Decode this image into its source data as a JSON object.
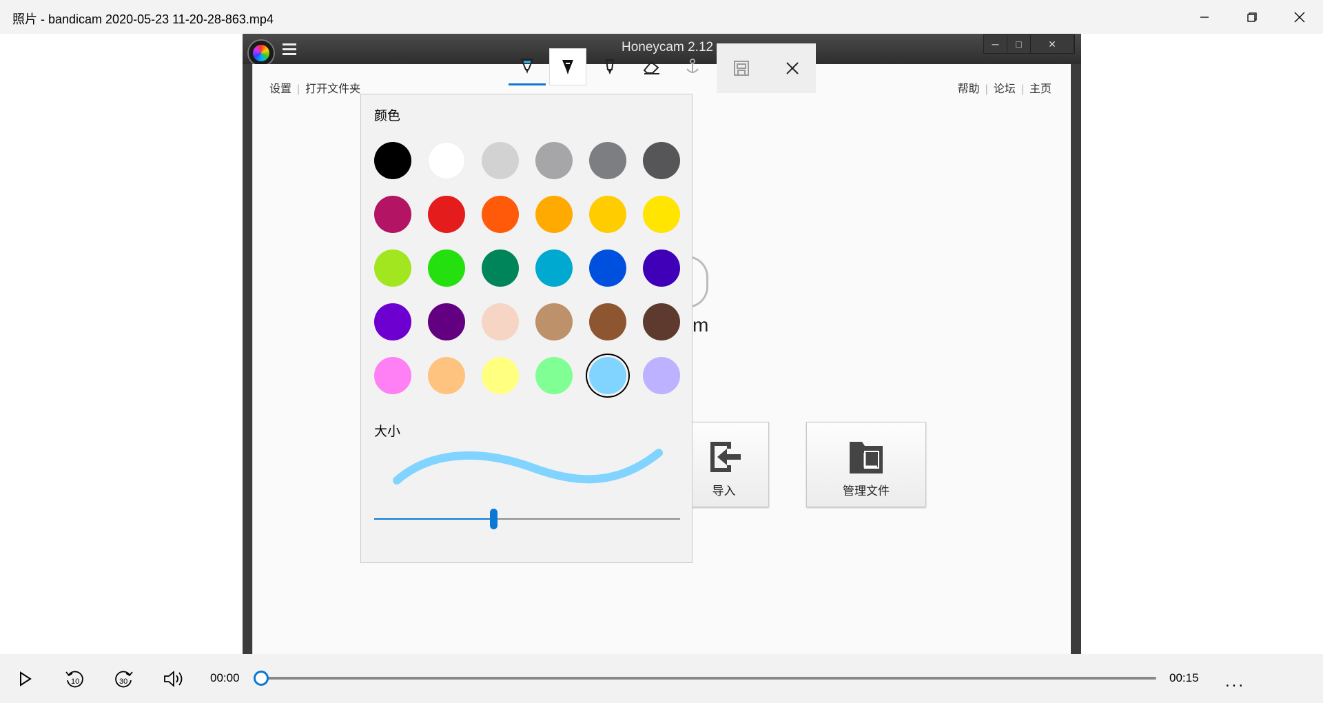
{
  "app_title": "照片 - bandicam 2020-05-23 11-20-28-863.mp4",
  "window_controls": {
    "minimize": "minimize-icon",
    "restore": "restore-icon",
    "close": "close-icon"
  },
  "honeycam": {
    "title": "Honeycam 2.12",
    "nav_left": [
      "设置",
      "打开文件夹"
    ],
    "nav_right": [
      "帮助",
      "论坛",
      "主页"
    ],
    "subtitle_fragment": "m",
    "buttons": [
      {
        "label": "导入",
        "icon": "import-icon"
      },
      {
        "label": "管理文件",
        "icon": "folder-manage-icon"
      }
    ]
  },
  "toolbar": {
    "tools": [
      "ballpoint-pen-icon",
      "calligraphy-pen-icon",
      "pencil-icon",
      "eraser-icon",
      "ruler-icon"
    ],
    "active_tool": "ballpoint-pen-icon",
    "save_icon": "save-icon",
    "close_icon": "close-icon"
  },
  "color_panel": {
    "color_heading": "颜色",
    "size_heading": "大小",
    "colors": [
      [
        "#000000",
        "#ffffff",
        "#d2d2d2",
        "#a6a6a8",
        "#7d7e82",
        "#565658"
      ],
      [
        "#b31564",
        "#e41c1c",
        "#ff5a0a",
        "#ffaa00",
        "#ffcc00",
        "#ffe500"
      ],
      [
        "#a2e620",
        "#24e00e",
        "#00855a",
        "#00a9cf",
        "#0050e0",
        "#3f00b8"
      ],
      [
        "#6d00d0",
        "#630081",
        "#f7d5c4",
        "#bd916a",
        "#8d5530",
        "#5e3a2e"
      ],
      [
        "#ff80f5",
        "#ffc380",
        "#ffff80",
        "#80ff95",
        "#80d4ff",
        "#bcb2ff"
      ]
    ],
    "selected_color": "#80d4ff",
    "size_fraction": 0.39
  },
  "player": {
    "current_time": "00:00",
    "total_time": "00:15",
    "progress": 0,
    "buttons": [
      "play-icon",
      "rewind-10-icon",
      "forward-30-icon",
      "volume-icon",
      "more-icon"
    ],
    "skip_back": "10",
    "skip_forward": "30",
    "more_label": "..."
  }
}
